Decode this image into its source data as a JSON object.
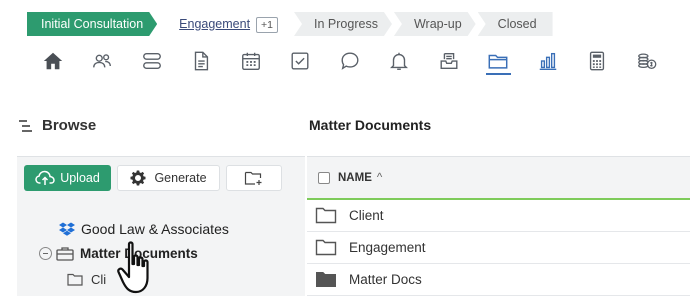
{
  "stages": [
    {
      "label": "Initial Consultation",
      "state": "active"
    },
    {
      "label": "Engagement",
      "state": "current",
      "badge": "+1"
    },
    {
      "label": "In Progress",
      "state": "upcoming"
    },
    {
      "label": "Wrap-up",
      "state": "upcoming"
    },
    {
      "label": "Closed",
      "state": "upcoming"
    }
  ],
  "toolbar_icons": [
    "home-icon",
    "contacts-icon",
    "tasks-icon",
    "document-icon",
    "calendar-icon",
    "checkbox-icon",
    "comment-icon",
    "bell-icon",
    "inbox-icon",
    "folder-icon",
    "chart-icon",
    "calculator-icon",
    "billing-icon"
  ],
  "selected_icon": "folder-icon",
  "browse": {
    "title": "Browse"
  },
  "actions": {
    "upload": "Upload",
    "generate": "Generate"
  },
  "tree": {
    "root": "Good Law & Associates",
    "matter": "Matter Documents",
    "child": "Cli"
  },
  "documents": {
    "title": "Matter Documents",
    "column_name": "NAME",
    "sort_indicator": "^",
    "rows": [
      "Client",
      "Engagement",
      "Matter Docs"
    ]
  },
  "colors": {
    "accent": "#2d9b6f",
    "active_underline": "#3a6fb7",
    "divider": "#7ecb5a"
  }
}
